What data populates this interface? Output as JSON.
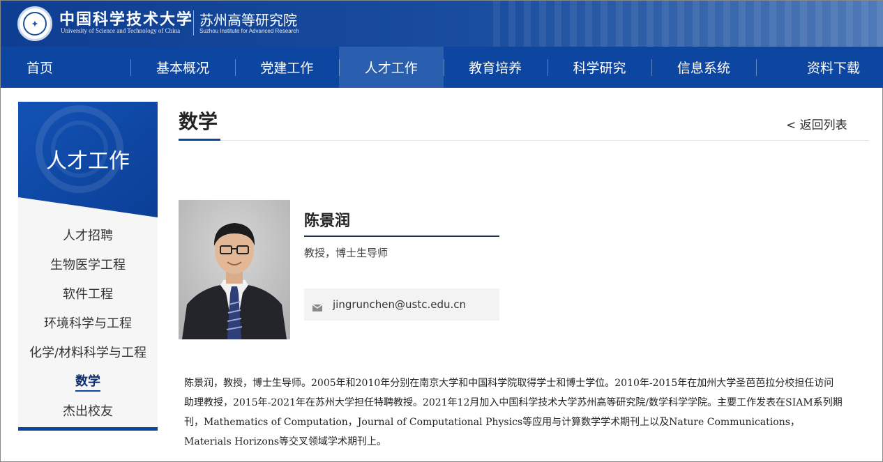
{
  "header": {
    "university_cn": "中国科学技术大学",
    "university_en": "University of Science and Technology of China",
    "institute_cn": "苏州高等研究院",
    "institute_en": "Suzhou Institute for Advanced Research",
    "brand_color": "#0d46a0"
  },
  "nav": {
    "items": [
      {
        "label": "首页",
        "active": false
      },
      {
        "label": "基本概况",
        "active": false
      },
      {
        "label": "党建工作",
        "active": false
      },
      {
        "label": "人才工作",
        "active": true
      },
      {
        "label": "教育培养",
        "active": false
      },
      {
        "label": "科学研究",
        "active": false
      },
      {
        "label": "信息系统",
        "active": false
      },
      {
        "label": "资料下载",
        "active": false
      }
    ]
  },
  "sidebar": {
    "title": "人才工作",
    "items": [
      {
        "label": "人才招聘",
        "active": false
      },
      {
        "label": "生物医学工程",
        "active": false
      },
      {
        "label": "软件工程",
        "active": false
      },
      {
        "label": "环境科学与工程",
        "active": false
      },
      {
        "label": "化学/材料科学与工程",
        "active": false
      },
      {
        "label": "数学",
        "active": true
      },
      {
        "label": "杰出校友",
        "active": false
      }
    ]
  },
  "main": {
    "page_title": "数学",
    "back_link": "< 返回列表",
    "person": {
      "name": "陈景润",
      "title": "教授，博士生导师",
      "email": "jingrunchen@ustc.edu.cn",
      "email_icon": "mail-icon"
    },
    "bio": "陈景润，教授，博士生导师。2005年和2010年分别在南京大学和中国科学院取得学士和博士学位。2010年-2015年在加州大学圣芭芭拉分校担任访问助理教授，2015年-2021年在苏州大学担任特聘教授。2021年12月加入中国科学技术大学苏州高等研究院/数学科学学院。主要工作发表在SIAM系列期刊，Mathematics of Computation，Journal of Computational Physics等应用与计算数学学术期刊上以及Nature Communications，Materials Horizons等交叉领域学术期刊上。"
  }
}
